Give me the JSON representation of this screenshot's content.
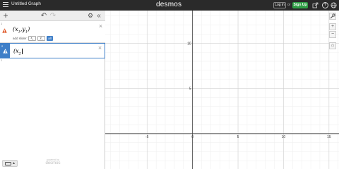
{
  "header": {
    "graph_title": "Untitled Graph",
    "logo": "desmos",
    "login_label": "Log in",
    "or_label": "or",
    "signup_label": "Sign Up",
    "help_label": "?",
    "icons": [
      "menu-icon",
      "share-icon",
      "help-icon",
      "globe-icon"
    ]
  },
  "toolbar": {
    "add_label": "+",
    "undo_label": "↶",
    "redo_label": "↷",
    "settings_label": "⚙",
    "collapse_label": "«"
  },
  "expressions": [
    {
      "index": "1",
      "tokens": [
        "(",
        "x",
        "1",
        ",",
        "y",
        "1",
        ")"
      ],
      "close_label": "×",
      "slider_prompt": "add slider:",
      "slider_chips": [
        {
          "var": "x",
          "sub": "1"
        },
        {
          "var": "y",
          "sub": "1"
        }
      ],
      "all_label": "all"
    },
    {
      "index": "2",
      "tokens": [
        "(",
        "x",
        "2"
      ],
      "close_label": "×"
    }
  ],
  "empty_index": "3",
  "footer": {
    "powered_by": "powered by",
    "brand": "desmos"
  },
  "graph_controls": {
    "wrench_label": "🔧",
    "zoom_in_label": "+",
    "zoom_out_label": "−",
    "home_label": "⌂"
  },
  "colors": {
    "accent": "#3f7fc8",
    "signup": "#2f9e45",
    "warning": "#e05a2b",
    "topbar": "#2a2a2a"
  },
  "chart_data": {
    "type": "scatter",
    "xlim": [
      -9.6,
      16.1
    ],
    "ylim": [
      -3.9,
      13.6
    ],
    "grid": true,
    "x_ticks": [
      -5,
      0,
      5,
      10,
      15
    ],
    "y_ticks": [
      5,
      10
    ],
    "x_tick_labels": [
      "-5",
      "0",
      "5",
      "10",
      "15"
    ],
    "y_tick_labels": [
      "5",
      "10"
    ],
    "series": []
  }
}
